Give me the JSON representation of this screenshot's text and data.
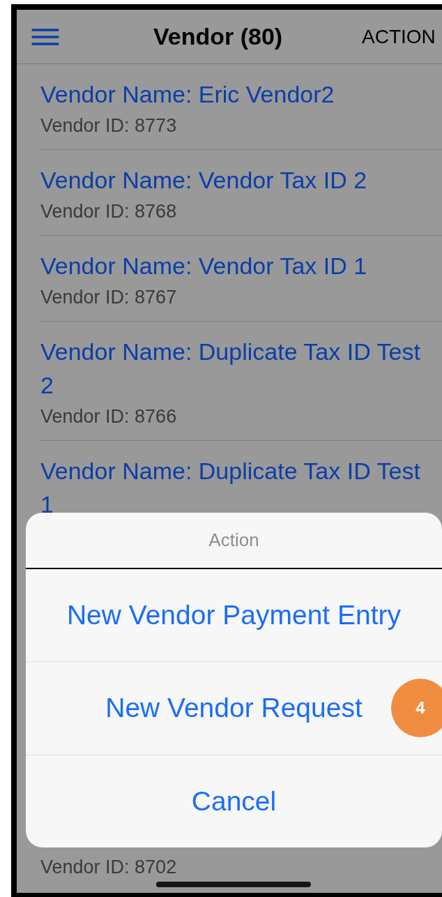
{
  "header": {
    "title": "Vendor (80)",
    "action": "ACTION"
  },
  "vendors": [
    {
      "name": "Vendor Name: Eric Vendor2",
      "id": "Vendor ID: 8773"
    },
    {
      "name": "Vendor Name: Vendor Tax ID 2",
      "id": "Vendor ID: 8768"
    },
    {
      "name": "Vendor Name: Vendor Tax ID 1",
      "id": "Vendor ID: 8767"
    },
    {
      "name": "Vendor Name: Duplicate Tax ID Test 2",
      "id": "Vendor ID: 8766"
    },
    {
      "name": "Vendor Name: Duplicate Tax ID Test 1"
    }
  ],
  "last_vendor_id": "Vendor ID: 8702",
  "action_sheet": {
    "title": "Action",
    "options": [
      {
        "label": "New Vendor Payment Entry"
      },
      {
        "label": "New Vendor Request",
        "badge": "4"
      }
    ],
    "cancel": "Cancel"
  }
}
